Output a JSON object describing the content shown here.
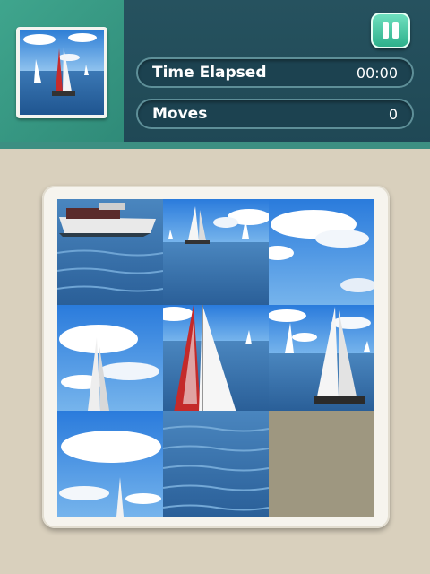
{
  "header": {
    "time_label": "Time Elapsed",
    "time_value": "00:00",
    "moves_label": "Moves",
    "moves_value": "0",
    "pause_icon": "pause-icon",
    "preview_icon": "puzzle-preview-image"
  },
  "puzzle": {
    "rows": 3,
    "cols": 3,
    "tiles": [
      {
        "position": 1,
        "content": "motor-boat-water",
        "empty": false
      },
      {
        "position": 2,
        "content": "sailboats-horizon",
        "empty": false
      },
      {
        "position": 3,
        "content": "sky-clouds",
        "empty": false
      },
      {
        "position": 4,
        "content": "sail-mast-clouds",
        "empty": false
      },
      {
        "position": 5,
        "content": "red-white-sails",
        "empty": false
      },
      {
        "position": 6,
        "content": "sailboat-sea",
        "empty": false
      },
      {
        "position": 7,
        "content": "clouds-mast-top",
        "empty": false
      },
      {
        "position": 8,
        "content": "water-waves",
        "empty": false
      },
      {
        "position": 9,
        "content": "empty-slot",
        "empty": true
      }
    ]
  },
  "colors": {
    "header": "#22505d",
    "header_accent": "#3aa08a",
    "board_bg": "#d9d0bd",
    "empty_tile": "#9e9780",
    "sea": "#2f6fae",
    "sky": "#3c86d9"
  }
}
